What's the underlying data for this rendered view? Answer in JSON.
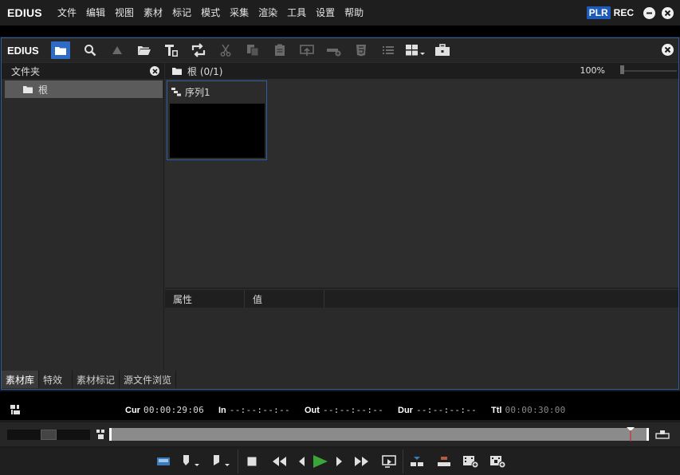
{
  "app": {
    "logo": "EDIUS"
  },
  "menu": [
    "文件",
    "编辑",
    "视图",
    "素材",
    "标记",
    "模式",
    "采集",
    "渲染",
    "工具",
    "设置",
    "帮助"
  ],
  "player_mode": {
    "plr": "PLR",
    "rec": "REC"
  },
  "bin": {
    "logo": "EDIUS",
    "toolbar_icons": [
      "folder-view-icon",
      "search-icon",
      "up-folder-icon",
      "open-folder-icon",
      "add-title-icon",
      "sync-icon",
      "cut-icon",
      "copy-icon",
      "paste-icon",
      "send-to-player-icon",
      "add-to-timeline-icon",
      "html5-icon",
      "list-view-icon",
      "thumbnail-view-icon",
      "toolbox-icon"
    ],
    "folder_panel": {
      "title": "文件夹",
      "root": "根"
    },
    "clip_view": {
      "path": "根 (0/1)",
      "zoom": "100%"
    },
    "clips": [
      {
        "name": "序列1"
      }
    ],
    "properties": {
      "col_attr": "属性",
      "col_value": "值"
    },
    "tabs": [
      "素材库",
      "特效",
      "素材标记",
      "源文件浏览"
    ]
  },
  "timecodes": {
    "cur_label": "Cur",
    "cur_value": "00:00:29:06",
    "in_label": "In",
    "in_value": "--:--:--:--",
    "out_label": "Out",
    "out_value": "--:--:--:--",
    "dur_label": "Dur",
    "dur_value": "--:--:--:--",
    "ttl_label": "Ttl",
    "ttl_value": "00:00:30:00"
  },
  "playback": {
    "position_fraction": 0.97
  },
  "colors": {
    "accent": "#2e6bc6",
    "play": "#3aa63a",
    "border": "#2d5fa0"
  }
}
